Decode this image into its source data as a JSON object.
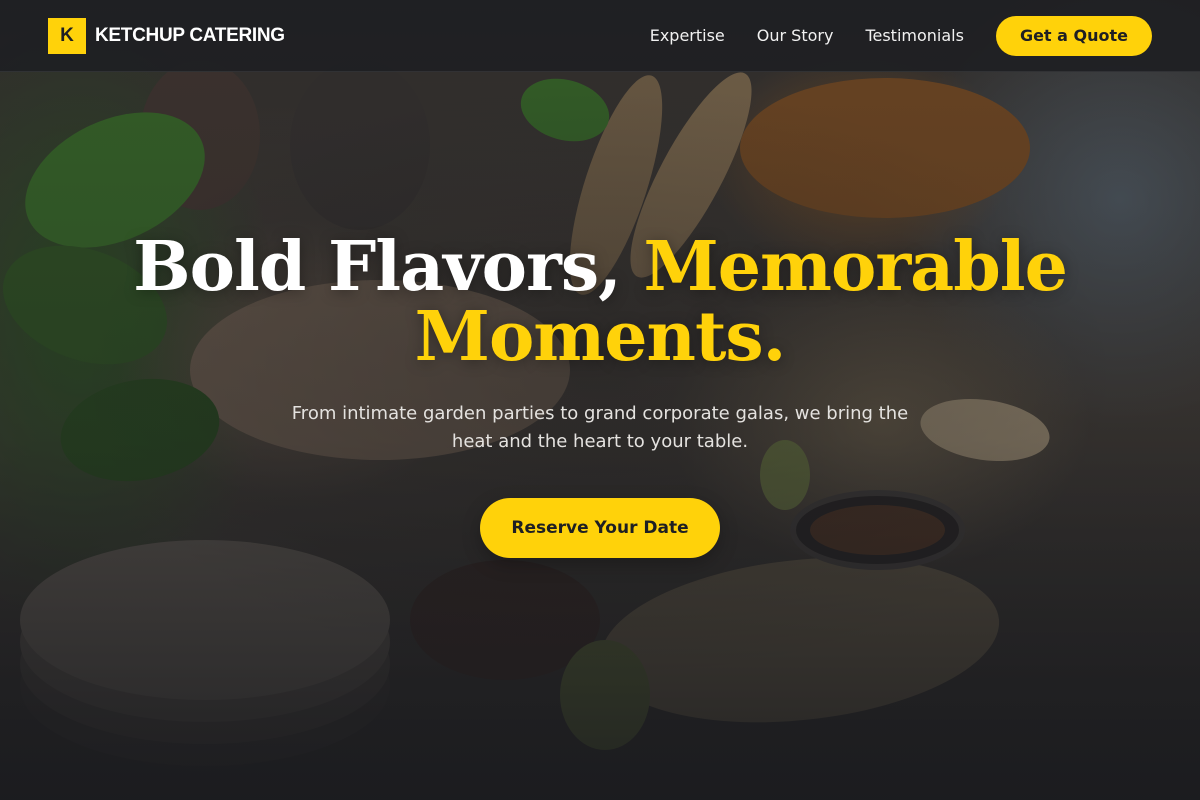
{
  "header": {
    "logo_letter": "K",
    "brand_name": "KETCHUP CATERING",
    "nav": [
      {
        "label": "Expertise"
      },
      {
        "label": "Our Story"
      },
      {
        "label": "Testimonials"
      }
    ],
    "cta_label": "Get a Quote"
  },
  "hero": {
    "headline_plain": "Bold Flavors, ",
    "headline_accent_1": "Memorable",
    "headline_accent_2": "Moments.",
    "subtext": "From intimate garden parties to grand corporate galas, we bring the heat and the heart to your table.",
    "cta_label": "Reserve Your Date",
    "background_image": "catering-buffet-photo"
  },
  "colors": {
    "accent": "#ffd20a",
    "header_bg": "#1e1f23",
    "text_light": "#ffffff"
  }
}
